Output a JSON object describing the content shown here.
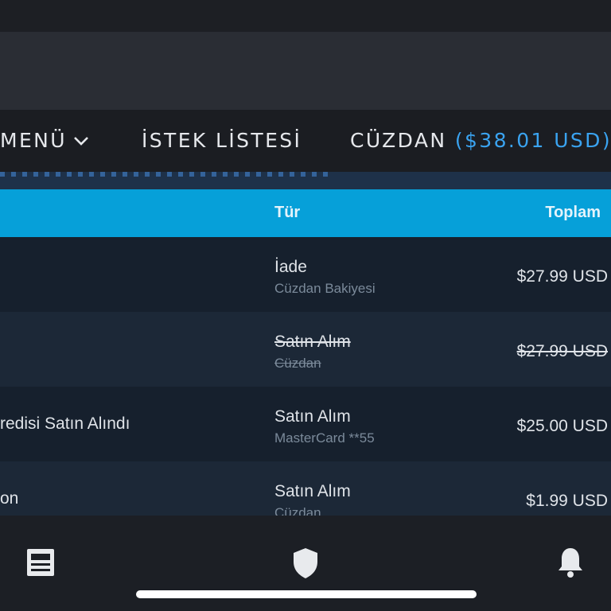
{
  "nav": {
    "menu_label": "MENÜ",
    "wishlist_label": "İSTEK LİSTESİ",
    "wallet_label": "CÜZDAN",
    "wallet_balance": "($38.01 USD)"
  },
  "table": {
    "headers": {
      "type": "Tür",
      "total": "Toplam"
    },
    "rows": [
      {
        "desc": "",
        "type": "İade",
        "method": "Cüzdan Bakiyesi",
        "amount": "$27.99 USD",
        "strikethrough": false
      },
      {
        "desc": "",
        "type": "Satın Alım",
        "method": "Cüzdan",
        "amount": "$27.99 USD",
        "strikethrough": true
      },
      {
        "desc": "redisi Satın Alındı",
        "type": "Satın Alım",
        "method": "MasterCard **55",
        "amount": "$25.00 USD",
        "strikethrough": false
      },
      {
        "desc": "on",
        "type": "Satın Alım",
        "method": "Cüzdan",
        "amount": "$1.99 USD",
        "strikethrough": false
      }
    ]
  },
  "tabbar": {
    "icons": [
      "news-icon",
      "shield-icon",
      "bell-icon"
    ]
  },
  "colors": {
    "accent": "#3aa3f0",
    "table_header": "#06a0d9"
  }
}
